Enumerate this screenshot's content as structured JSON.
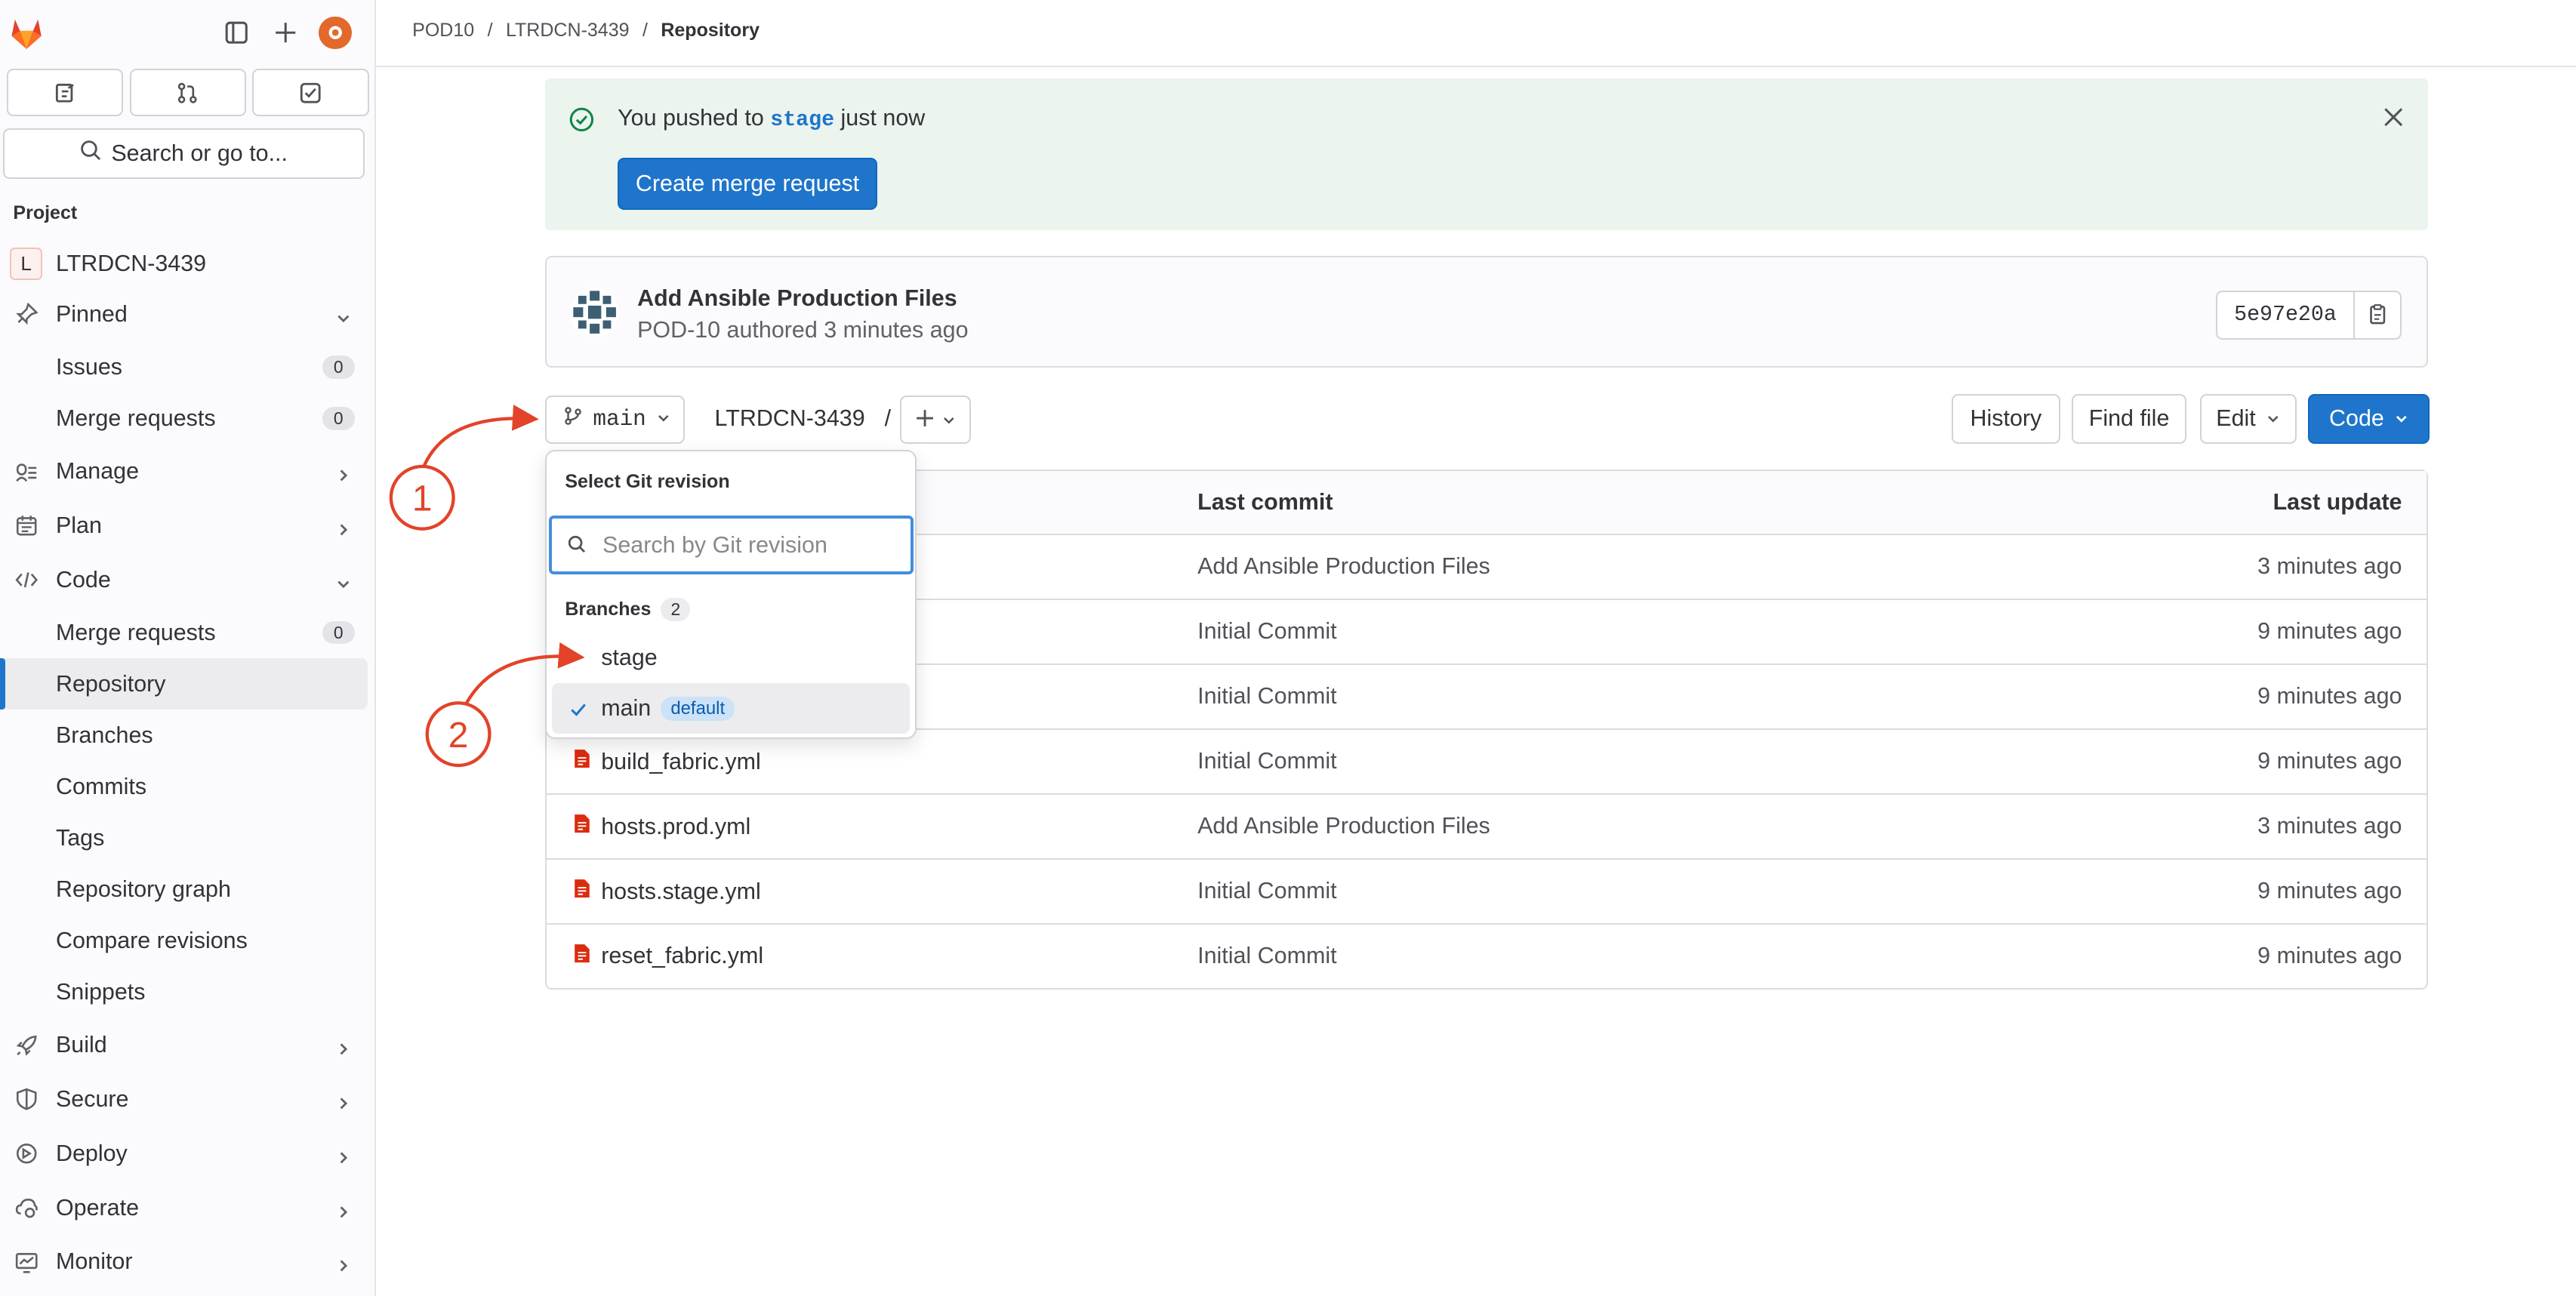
{
  "breadcrumb": {
    "items": [
      "POD10",
      "LTRDCN-3439",
      "Repository"
    ]
  },
  "sidebar": {
    "search_label": "Search or go to...",
    "section_title": "Project",
    "project_initial": "L",
    "project_name": "LTRDCN-3439",
    "items": [
      {
        "label": "Pinned"
      },
      {
        "label": "Issues",
        "count": "0"
      },
      {
        "label": "Merge requests",
        "count": "0"
      },
      {
        "label": "Manage"
      },
      {
        "label": "Plan"
      },
      {
        "label": "Code"
      },
      {
        "label": "Merge requests",
        "count": "0"
      },
      {
        "label": "Repository"
      },
      {
        "label": "Branches"
      },
      {
        "label": "Commits"
      },
      {
        "label": "Tags"
      },
      {
        "label": "Repository graph"
      },
      {
        "label": "Compare revisions"
      },
      {
        "label": "Snippets"
      },
      {
        "label": "Build"
      },
      {
        "label": "Secure"
      },
      {
        "label": "Deploy"
      },
      {
        "label": "Operate"
      },
      {
        "label": "Monitor"
      }
    ]
  },
  "alert": {
    "prefix": "You pushed to",
    "branch": "stage",
    "suffix": "just now",
    "button": "Create merge request"
  },
  "commit": {
    "title": "Add Ansible Production Files",
    "meta": "POD-10 authored 3 minutes ago",
    "sha": "5e97e20a"
  },
  "toolbar": {
    "branch": "main",
    "path": "LTRDCN-3439",
    "sep": "/",
    "history": "History",
    "find_file": "Find file",
    "edit": "Edit",
    "code": "Code"
  },
  "table": {
    "headers": {
      "name": "",
      "last_commit": "Last commit",
      "last_update": "Last update"
    },
    "rows": [
      {
        "name": "",
        "commit": "Add Ansible Production Files",
        "date": "3 minutes ago"
      },
      {
        "name": "",
        "commit": "Initial Commit",
        "date": "9 minutes ago"
      },
      {
        "name": "",
        "commit": "Initial Commit",
        "date": "9 minutes ago"
      },
      {
        "name": "build_fabric.yml",
        "commit": "Initial Commit",
        "date": "9 minutes ago"
      },
      {
        "name": "hosts.prod.yml",
        "commit": "Add Ansible Production Files",
        "date": "3 minutes ago"
      },
      {
        "name": "hosts.stage.yml",
        "commit": "Initial Commit",
        "date": "9 minutes ago"
      },
      {
        "name": "reset_fabric.yml",
        "commit": "Initial Commit",
        "date": "9 minutes ago"
      }
    ]
  },
  "dropdown": {
    "title": "Select Git revision",
    "search_placeholder": "Search by Git revision",
    "section": "Branches",
    "section_count": "2",
    "options": [
      {
        "label": "stage"
      },
      {
        "label": "main",
        "tag": "default"
      }
    ]
  },
  "annotations": {
    "one": "1",
    "two": "2"
  },
  "colors": {
    "accent": "#1f75cb",
    "annotation": "#e24329",
    "alert_bg": "#ecf4ee",
    "file_icon": "#dd2b0e"
  }
}
